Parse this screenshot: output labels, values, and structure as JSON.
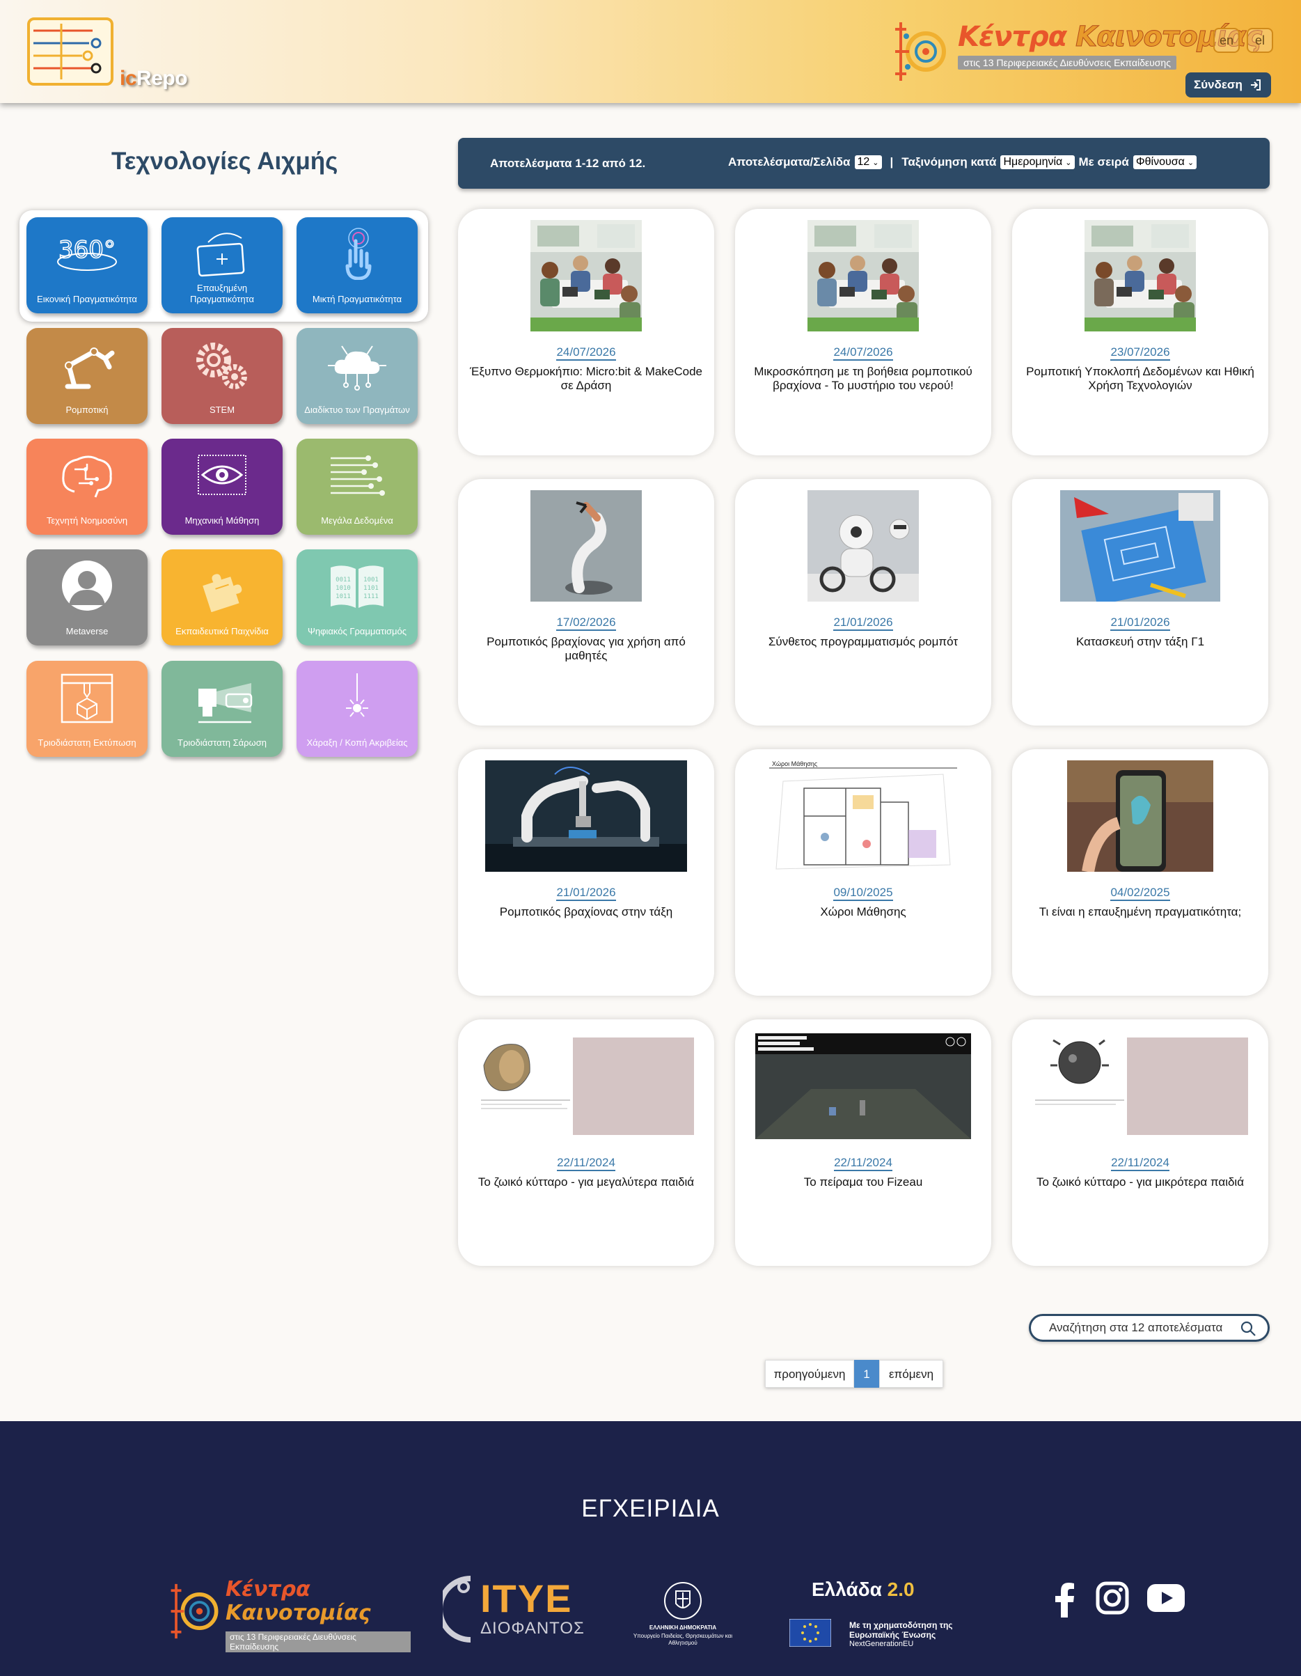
{
  "header": {
    "logo_ic": "ic",
    "logo_repo": "Repo",
    "brand_word1": "Κέντρα",
    "brand_word2": "Καινοτομίας",
    "brand_subtitle": "στις 13 Περιφερειακές Διευθύνσεις Εκπαίδευσης",
    "lang_en": "en",
    "lang_el": "el",
    "login_label": "Σύνδεση"
  },
  "sidebar": {
    "title": "Τεχνολογίες Αιχμής",
    "tiles": [
      {
        "label": "Εικονική Πραγματικότητα",
        "color": "#1e78c8",
        "icon": "vr-360-icon"
      },
      {
        "label": "Επαυξημένη Πραγματικότητα",
        "color": "#1e78c8",
        "icon": "ar-tablet-icon"
      },
      {
        "label": "Μικτή Πραγματικότητα",
        "color": "#1e78c8",
        "icon": "mixed-reality-hand-icon"
      },
      {
        "label": "Ρομποτική",
        "color": "#c38a48",
        "icon": "robot-arm-icon"
      },
      {
        "label": "STEM",
        "color": "#b85e5a",
        "icon": "gears-icon"
      },
      {
        "label": "Διαδίκτυο των Πραγμάτων",
        "color": "#8fb6be",
        "icon": "cloud-network-icon"
      },
      {
        "label": "Τεχνητή Νοημοσύνη",
        "color": "#f7845a",
        "icon": "brain-circuit-icon"
      },
      {
        "label": "Μηχανική Μάθηση",
        "color": "#6b2a8c",
        "icon": "eye-chip-icon"
      },
      {
        "label": "Μεγάλα Δεδομένα",
        "color": "#9bba6e",
        "icon": "data-lines-icon"
      },
      {
        "label": "Metaverse",
        "color": "#8a8a8a",
        "icon": "avatar-icon"
      },
      {
        "label": "Εκπαιδευτικά Παιχνίδια",
        "color": "#f8b430",
        "icon": "puzzle-icon"
      },
      {
        "label": "Ψηφιακός Γραμματισμός",
        "color": "#7fc8b0",
        "icon": "binary-book-icon"
      },
      {
        "label": "Τριοδιάστατη Εκτύπωση",
        "color": "#f8a46a",
        "icon": "3d-printer-icon"
      },
      {
        "label": "Τριοδιάστατη Σάρωση",
        "color": "#80b89a",
        "icon": "3d-scanner-icon"
      },
      {
        "label": "Χάραξη / Κοπή Ακριβείας",
        "color": "#cf9ef0",
        "icon": "laser-cut-icon"
      }
    ]
  },
  "results": {
    "count_text": "Αποτελέσματα 1-12 από 12.",
    "per_page_label": "Αποτελέσματα/Σελίδα",
    "per_page_value": "12",
    "separator": "|",
    "sort_label": "Ταξινόμηση κατά",
    "sort_value": "Ημερομηνία",
    "order_label": "Με σειρά",
    "order_value": "Φθίνουσα"
  },
  "cards": [
    {
      "date": "24/07/2026",
      "title": "Έξυπνο Θερμοκήπιο: Micro:bit & MakeCode σε Δράση",
      "thumb": "classroom-photo"
    },
    {
      "date": "24/07/2026",
      "title": "Μικροσκόπηση με τη βοήθεια ρομποτικού βραχίονα - Το μυστήριο του νερού!",
      "thumb": "classroom-photo"
    },
    {
      "date": "23/07/2026",
      "title": "Ρομποτική Υποκλοπή Δεδομένων και Ηθική Χρήση Τεχνολογιών",
      "thumb": "classroom-photo"
    },
    {
      "date": "17/02/2026",
      "title": "Ρομποτικός βραχίονας για χρήση από μαθητές",
      "thumb": "robot-arm-photo"
    },
    {
      "date": "21/01/2026",
      "title": "Σύνθετος προγραμματισμός ρομπότ",
      "thumb": "robot-photo"
    },
    {
      "date": "21/01/2026",
      "title": "Κατασκευή στην τάξη Γ1",
      "thumb": "blueprint-photo"
    },
    {
      "date": "21/01/2026",
      "title": "Ρομποτικός βραχίονας στην τάξη",
      "thumb": "factory-photo"
    },
    {
      "date": "09/10/2025",
      "title": "Χώροι Μάθησης",
      "thumb": "floorplan",
      "thumb_caption": "Χώροι Μάθησης"
    },
    {
      "date": "04/02/2025",
      "title": "Τι είναι η επαυξημένη πραγματικότητα;",
      "thumb": "ar-phone-photo"
    },
    {
      "date": "22/11/2024",
      "title": "Το ζωικό κύτταρο - για μεγαλύτερα παιδιά",
      "thumb": "cell-app"
    },
    {
      "date": "22/11/2024",
      "title": "Το πείραμα του Fizeau",
      "thumb": "fizeau-app"
    },
    {
      "date": "22/11/2024",
      "title": "Το ζωικό κύτταρο - για μικρότερα παιδιά",
      "thumb": "cell-app-2"
    }
  ],
  "search": {
    "placeholder": "Αναζήτηση στα 12 αποτελέσματα"
  },
  "pagination": {
    "prev": "προηγούμενη",
    "current": "1",
    "next": "επόμενη"
  },
  "footer": {
    "manuals": "ΕΓΧΕΙΡΙΔΙΑ",
    "kk_word1": "Κέντρα",
    "kk_word2": "Καινοτομίας",
    "kk_subtitle": "στις 13 Περιφερειακές Διευθύνσεις Εκπαίδευσης",
    "itye_name": "ΙΤΥΕ",
    "itye_sub": "ΔΙΟΦΑΝΤΟΣ",
    "gov_title": "ΕΛΛΗΝΙΚΗ ΔΗΜΟΚΡΑΤΙΑ",
    "gov_ministry": "Υπουργείο Παιδείας, Θρησκευμάτων και Αθλητισμού",
    "greece_name": "Ελλάδα",
    "greece_version": "2.0",
    "greece_funding": "Με τη χρηματοδότηση της Ευρωπαϊκής Ένωσης",
    "greece_ngeu": "NextGenerationEU",
    "social": [
      "facebook-icon",
      "instagram-icon",
      "youtube-icon"
    ]
  }
}
